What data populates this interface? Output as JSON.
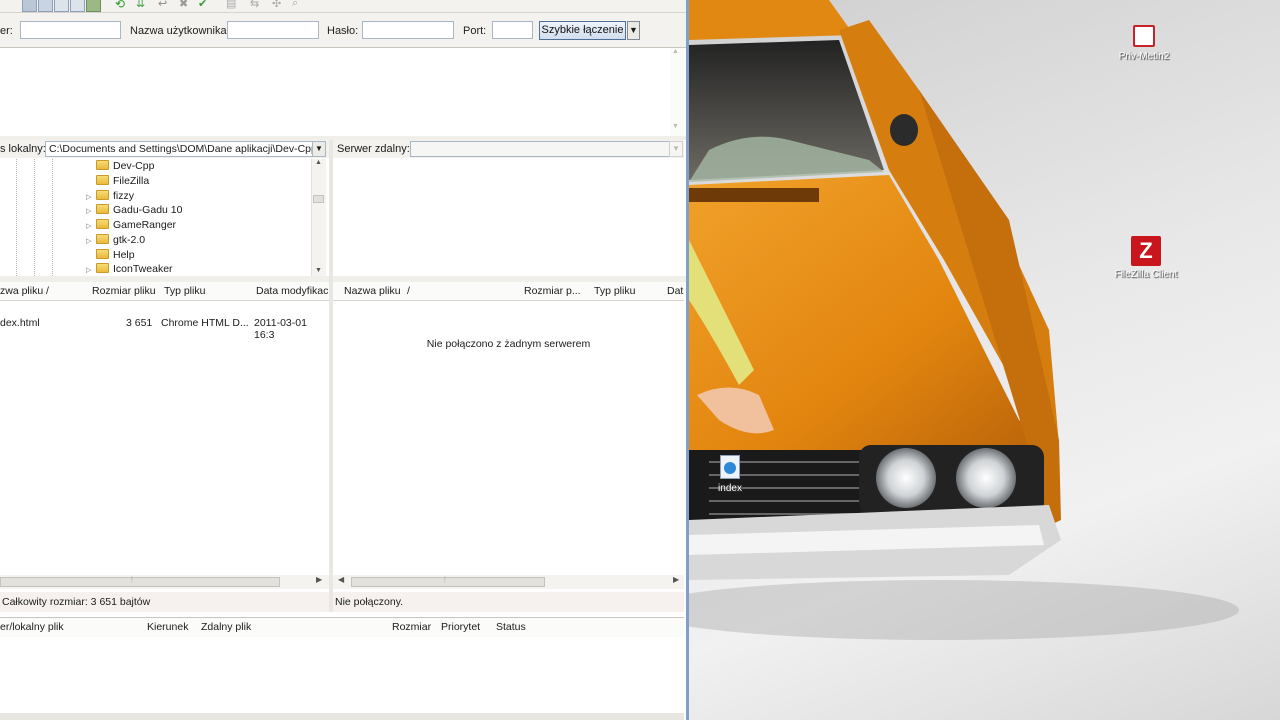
{
  "quickconnect": {
    "host_label": "er:",
    "user_label": "Nazwa użytkownika:",
    "pass_label": "Hasło:",
    "port_label": "Port:",
    "button": "Szybkie łączenie"
  },
  "local": {
    "path_label": "s lokalny:",
    "path_value": "C:\\Documents and Settings\\DOM\\Dane aplikacji\\Dev-Cpp\\",
    "tree": [
      "Dev-Cpp",
      "FileZilla",
      "fizzy",
      "Gadu-Gadu 10",
      "GameRanger",
      "gtk-2.0",
      "Help",
      "IconTweaker"
    ],
    "columns": {
      "name": "zwa pliku",
      "sort": "/",
      "size": "Rozmiar pliku",
      "type": "Typ pliku",
      "date": "Data modyfikac"
    },
    "files": [
      {
        "name": "dex.html",
        "size": "3 651",
        "type": "Chrome HTML D...",
        "date": "2011-03-01 16:3"
      }
    ],
    "status": "Całkowity rozmiar: 3 651 bajtów"
  },
  "remote": {
    "path_label": "Serwer zdalny:",
    "columns": {
      "name": "Nazwa pliku",
      "sort": "/",
      "size": "Rozmiar p...",
      "type": "Typ pliku",
      "date": "Dat"
    },
    "empty_message": "Nie połączono z żadnym serwerem",
    "status": "Nie połączony."
  },
  "queue": {
    "columns": {
      "server": "er/lokalny plik",
      "direction": "Kierunek",
      "remote": "Zdalny plik",
      "size": "Rozmiar",
      "priority": "Priorytet",
      "status": "Status"
    }
  },
  "desktop": {
    "icons": [
      {
        "label": "Priv-Metin2",
        "icon": "red-application-icon"
      },
      {
        "label": "FileZilla Client",
        "icon": "filezilla-icon"
      },
      {
        "label": "index",
        "icon": "html-document-icon"
      }
    ],
    "wallpaper": "orange car wallpaper"
  },
  "colors": {
    "accent": "#4e6f98",
    "window_border": "#7fa1c8",
    "car": "#e48a14"
  }
}
